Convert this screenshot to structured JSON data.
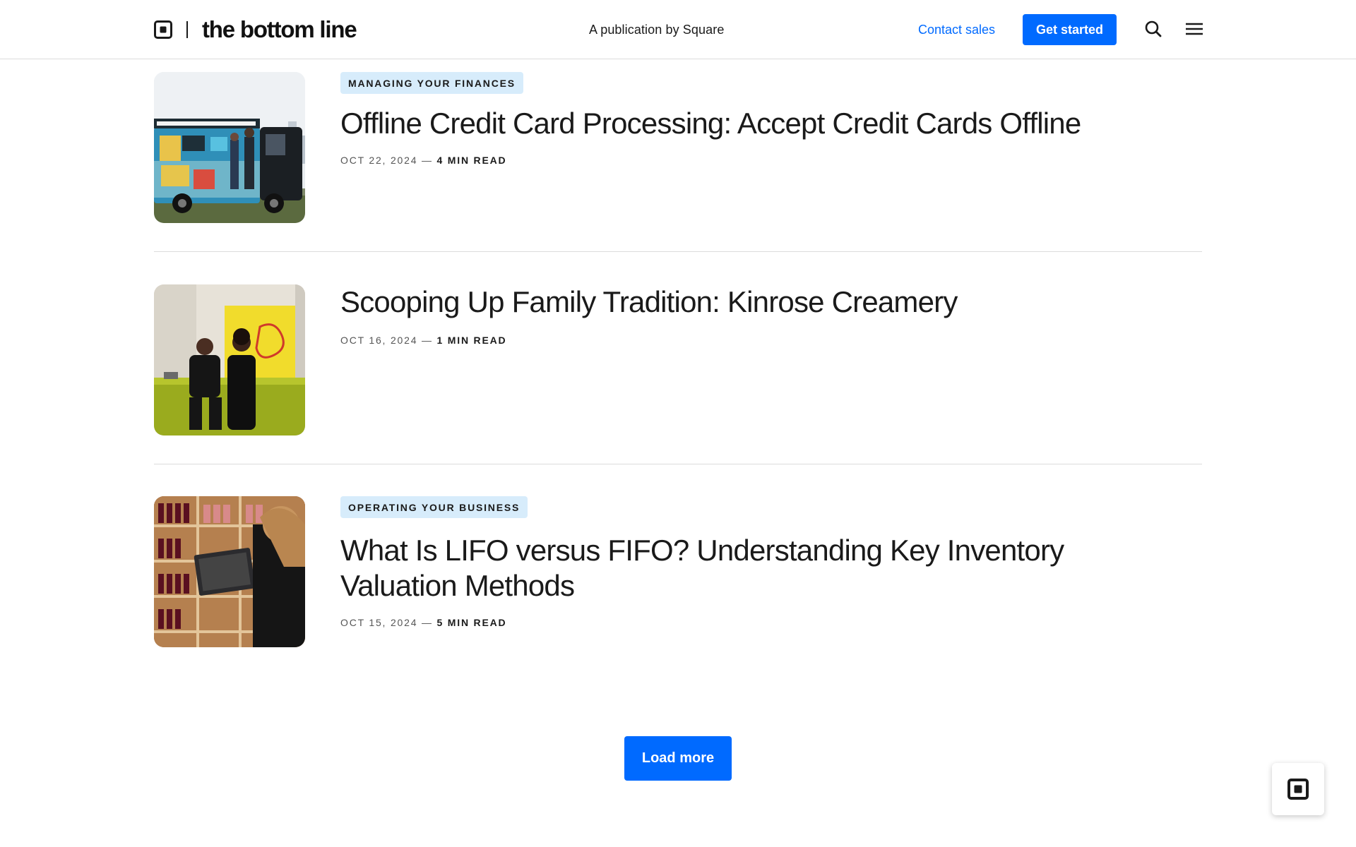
{
  "header": {
    "brand_name": "the bottom line",
    "tagline": "A publication by Square",
    "contact_sales": "Contact sales",
    "get_started": "Get started",
    "search_icon": "search-icon",
    "menu_icon": "hamburger-menu-icon"
  },
  "articles": [
    {
      "tag": "MANAGING YOUR FINANCES",
      "title": "Offline Credit Card Processing: Accept Credit Cards Offline",
      "date": "OCT 22, 2024",
      "separator": "—",
      "read_time": "4 MIN READ",
      "image": "food-truck-photo"
    },
    {
      "tag": "",
      "title": "Scooping Up Family Tradition: Kinrose Creamery",
      "date": "OCT 16, 2024",
      "separator": "—",
      "read_time": "1 MIN READ",
      "image": "creamery-owners-photo"
    },
    {
      "tag": "OPERATING YOUR BUSINESS",
      "title_line1": "What Is LIFO versus FIFO? Understanding Key Inventory",
      "title_line2": "Valuation Methods",
      "date": "OCT 15, 2024",
      "separator": "—",
      "read_time": "5 MIN READ",
      "image": "wine-shop-laptop-photo"
    }
  ],
  "load_more": "Load more",
  "colors": {
    "accent": "#006aff",
    "tag_bg": "#d7ecfb",
    "text": "#1a1a1a",
    "divider": "#dcdcdc"
  }
}
